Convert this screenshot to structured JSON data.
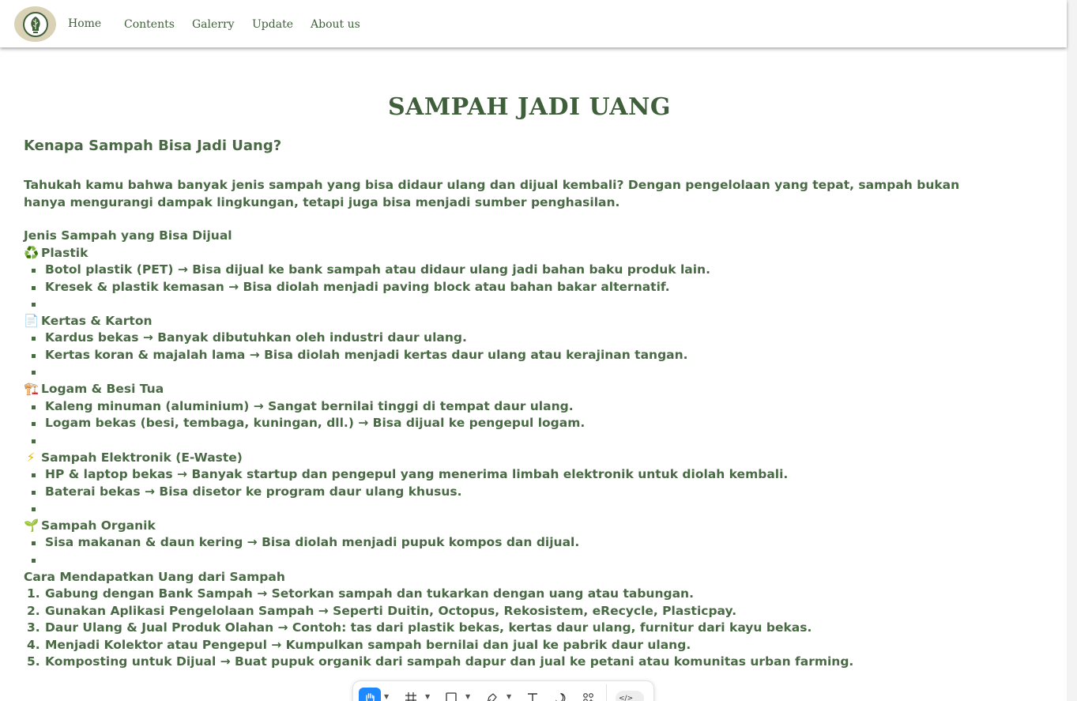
{
  "nav": {
    "logo_icon": "leaf-lightbulb-icon",
    "items": [
      "Home",
      "Contents",
      "Galerry",
      "Update",
      "About us"
    ]
  },
  "page": {
    "title": "SAMPAH JADI UANG",
    "heading": "Kenapa Sampah Bisa Jadi Uang?",
    "intro": "Tahukah kamu bahwa banyak jenis sampah yang bisa didaur ulang dan dijual kembali? Dengan pengelolaan yang tepat, sampah bukan hanya mengurangi dampak lingkungan, tetapi juga bisa menjadi sumber penghasilan.",
    "types_heading": "Jenis Sampah yang Bisa Dijual",
    "categories": [
      {
        "icon": "♻️",
        "icon_name": "recycle-icon",
        "name": "Plastik",
        "items": [
          "Botol plastik (PET) → Bisa dijual ke bank sampah atau didaur ulang jadi bahan baku produk lain.",
          "Kresek & plastik kemasan → Bisa diolah menjadi paving block atau bahan bakar alternatif.",
          ""
        ]
      },
      {
        "icon": "📄",
        "icon_name": "paper-icon",
        "name": "Kertas & Karton",
        "items": [
          "Kardus bekas → Banyak dibutuhkan oleh industri daur ulang.",
          "Kertas koran & majalah lama → Bisa diolah menjadi kertas daur ulang atau kerajinan tangan.",
          ""
        ]
      },
      {
        "icon": "🏗️",
        "icon_name": "crane-icon",
        "name": "Logam & Besi Tua",
        "items": [
          "Kaleng minuman (aluminium) → Sangat bernilai tinggi di tempat daur ulang.",
          "Logam bekas (besi, tembaga, kuningan, dll.) → Bisa dijual ke pengepul logam.",
          ""
        ]
      },
      {
        "icon": "⚡",
        "icon_name": "lightning-icon",
        "name": "Sampah Elektronik (E-Waste)",
        "items": [
          "HP & laptop bekas → Banyak startup dan pengepul yang menerima limbah elektronik untuk diolah kembali.",
          "Baterai bekas → Bisa disetor ke program daur ulang khusus.",
          ""
        ]
      },
      {
        "icon": "🌱",
        "icon_name": "sprout-icon",
        "name": "Sampah Organik",
        "items": [
          "Sisa makanan & daun kering → Bisa diolah menjadi pupuk kompos dan dijual.",
          ""
        ]
      }
    ],
    "steps_heading": "Cara Mendapatkan Uang dari Sampah",
    "steps": [
      {
        "num": "1.",
        "text": "Gabung dengan Bank Sampah → Setorkan sampah dan tukarkan dengan uang atau tabungan."
      },
      {
        "num": "2.",
        "text": "Gunakan Aplikasi Pengelolaan Sampah → Seperti Duitin, Octopus, Rekosistem, eRecycle, Plasticpay."
      },
      {
        "num": "3.",
        "text": "Daur Ulang & Jual Produk Olahan → Contoh: tas dari plastik bekas, kertas daur ulang, furnitur dari kayu bekas."
      },
      {
        "num": "4.",
        "text": "Menjadi Kolektor atau Pengepul → Kumpulkan sampah bernilai dan jual ke pabrik daur ulang."
      },
      {
        "num": "5.",
        "text": "Komposting untuk Dijual → Buat pupuk organik dari sampah dapur dan jual ke petani atau komunitas urban farming."
      }
    ]
  },
  "toolbar": {
    "tools": [
      "hand-tool-icon",
      "frame-tool-icon",
      "rectangle-tool-icon",
      "pen-tool-icon",
      "text-tool-icon",
      "comment-tool-icon",
      "components-icon",
      "code-toggle-icon"
    ],
    "accent": "#1e88ff"
  },
  "colors": {
    "text": "#4a6a45",
    "title": "#3f5f3b",
    "logo_bg": "#d9d2b6"
  }
}
